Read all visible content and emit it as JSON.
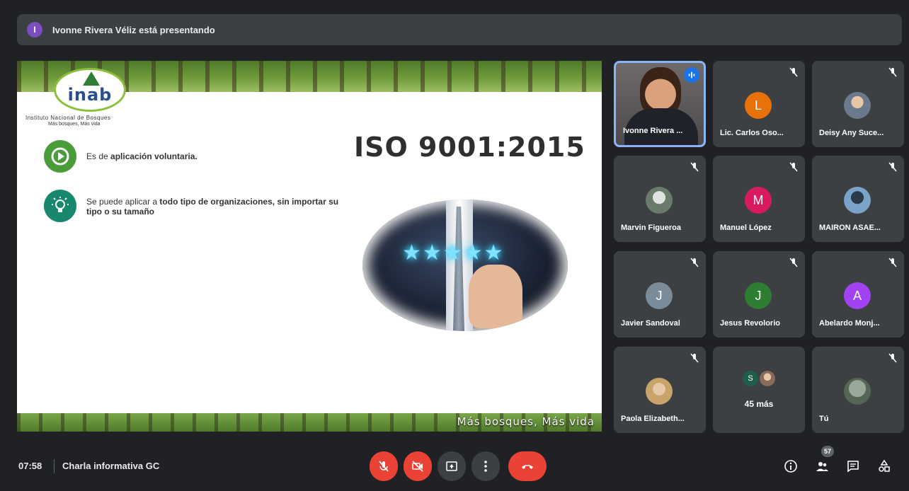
{
  "banner": {
    "avatar_letter": "I",
    "avatar_color": "#7b4dbf",
    "text": "Ivonne Rivera Véliz está presentando"
  },
  "slide": {
    "org_name": "Instituto Nacional de Bosques",
    "org_motto": "Más bosques, Más vida",
    "logo_text": "inab",
    "title": "ISO 9001:2015",
    "bullets": [
      {
        "pre": "Es de ",
        "bold": "aplicación voluntaria.",
        "post": "",
        "icon": "play-icon"
      },
      {
        "pre": "Se puede aplicar a ",
        "bold": "todo tipo de organizaciones, sin importar su tipo o su tamaño",
        "post": "",
        "icon": "lightbulb-icon"
      }
    ],
    "footer_motto": "Más bosques, Más vida",
    "image_stars": "★★★★★"
  },
  "participants": [
    {
      "name": "Ivonne Rivera ...",
      "kind": "video",
      "speaking": true
    },
    {
      "name": "Lic. Carlos Oso...",
      "letter": "L",
      "color": "#e8710a",
      "muted": true
    },
    {
      "name": "Deisy Any Suce...",
      "kind": "photo",
      "muted": true
    },
    {
      "name": "Marvin Figueroa",
      "kind": "photo",
      "muted": true
    },
    {
      "name": "Manuel López",
      "letter": "M",
      "color": "#d81b60",
      "muted": true
    },
    {
      "name": "MAIRON ASAE...",
      "kind": "photo",
      "muted": true
    },
    {
      "name": "Javier Sandoval",
      "letter": "J",
      "color": "#7a8b99",
      "muted": true
    },
    {
      "name": "Jesus Revolorio",
      "letter": "J",
      "color": "#2e7d32",
      "muted": true
    },
    {
      "name": "Abelardo Monj...",
      "letter": "A",
      "color": "#a142f4",
      "muted": true
    },
    {
      "name": "Paola Elizabeth...",
      "kind": "photo",
      "muted": true
    },
    {
      "name": "45 más",
      "kind": "more",
      "letter": "S",
      "color": "#1e5e4a"
    },
    {
      "name": "Tú",
      "kind": "photo",
      "muted": true
    }
  ],
  "bottom": {
    "time": "07:58",
    "meeting_title": "Charla informativa GC",
    "participant_count": "57"
  },
  "colors": {
    "end_call": "#ea4335",
    "control_dark": "#3c4043",
    "speaking": "#1a73e8",
    "active_border": "#8ab4f8"
  }
}
